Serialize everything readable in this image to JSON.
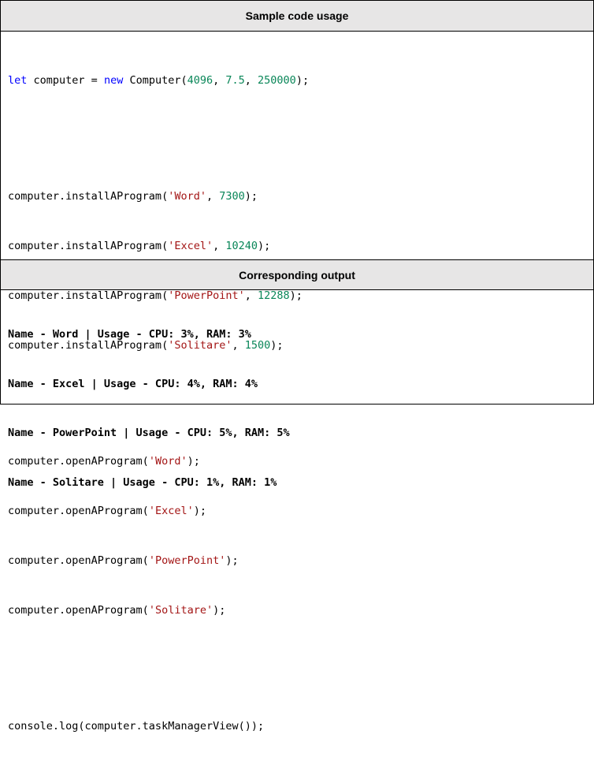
{
  "headers": {
    "sample": "Sample code usage",
    "output": "Corresponding output"
  },
  "code": {
    "line1": {
      "p0": "let",
      "p1": " computer = ",
      "p2": "new",
      "p3": " Computer(",
      "p4": "4096",
      "p5": ", ",
      "p6": "7.5",
      "p7": ", ",
      "p8": "250000",
      "p9": ");"
    },
    "install": [
      {
        "pre": "computer.installAProgram(",
        "str": "'Word'",
        "mid": ", ",
        "num": "7300",
        "end": ");"
      },
      {
        "pre": "computer.installAProgram(",
        "str": "'Excel'",
        "mid": ", ",
        "num": "10240",
        "end": ");"
      },
      {
        "pre": "computer.installAProgram(",
        "str": "'PowerPoint'",
        "mid": ", ",
        "num": "12288",
        "end": ");"
      },
      {
        "pre": "computer.installAProgram(",
        "str": "'Solitare'",
        "mid": ", ",
        "num": "1500",
        "end": ");"
      }
    ],
    "open": [
      {
        "pre": "computer.openAProgram(",
        "str": "'Word'",
        "end": ");"
      },
      {
        "pre": "computer.openAProgram(",
        "str": "'Excel'",
        "end": ");"
      },
      {
        "pre": "computer.openAProgram(",
        "str": "'PowerPoint'",
        "end": ");"
      },
      {
        "pre": "computer.openAProgram(",
        "str": "'Solitare'",
        "end": ");"
      }
    ],
    "last": "console.log(computer.taskManagerView());"
  },
  "output": [
    "Name - Word | Usage - CPU: 3%, RAM: 3%",
    "Name - Excel | Usage - CPU: 4%, RAM: 4%",
    "Name - PowerPoint | Usage - CPU: 5%, RAM: 5%",
    "Name - Solitare | Usage - CPU: 1%, RAM: 1%"
  ]
}
